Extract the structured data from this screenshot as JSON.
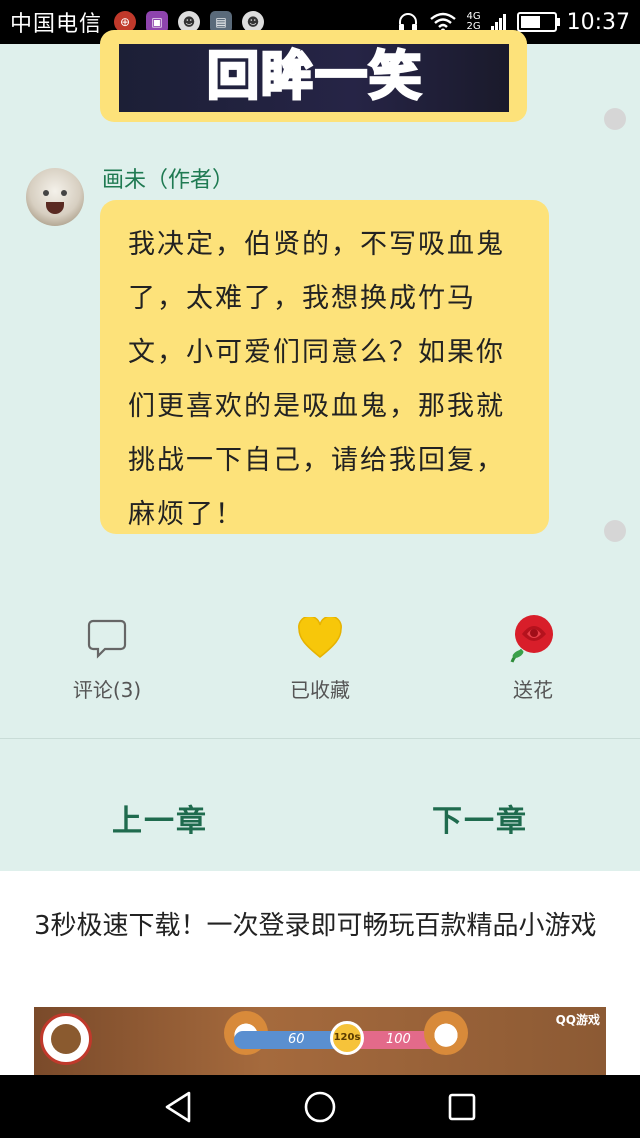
{
  "status_bar": {
    "carrier": "中国电信",
    "time": "10:37",
    "network_top": "4G",
    "network_bottom": "2G",
    "battery_level": 0.6
  },
  "previous_message": {
    "image_caption": "回眸一笑"
  },
  "message": {
    "author": "画未（作者）",
    "text": "我决定，伯贤的，不写吸血鬼了，太难了，我想换成竹马文，小可爱们同意么？如果你们更喜欢的是吸血鬼，那我就挑战一下自己，请给我回复，麻烦了！"
  },
  "actions": {
    "comment_label": "评论(3)",
    "favorite_label": "已收藏",
    "flower_label": "送花"
  },
  "chapter_nav": {
    "prev_label": "上一章",
    "next_label": "下一章"
  },
  "ad": {
    "headline": "3秒极速下载！一次登录即可畅玩百款精品小游戏",
    "score_left": "60",
    "timer": "120s",
    "score_right": "100",
    "logo": "QQ游戏"
  },
  "icons": {
    "comment": "speech-bubble-icon",
    "favorite": "heart-icon",
    "flower": "rose-icon",
    "back": "back-triangle-icon",
    "home": "home-circle-icon",
    "recents": "recents-square-icon"
  },
  "colors": {
    "background": "#dff0ec",
    "bubble": "#fde27a",
    "author": "#1f7a52",
    "chapter": "#1f6b4e",
    "heart": "#f7c70a"
  }
}
